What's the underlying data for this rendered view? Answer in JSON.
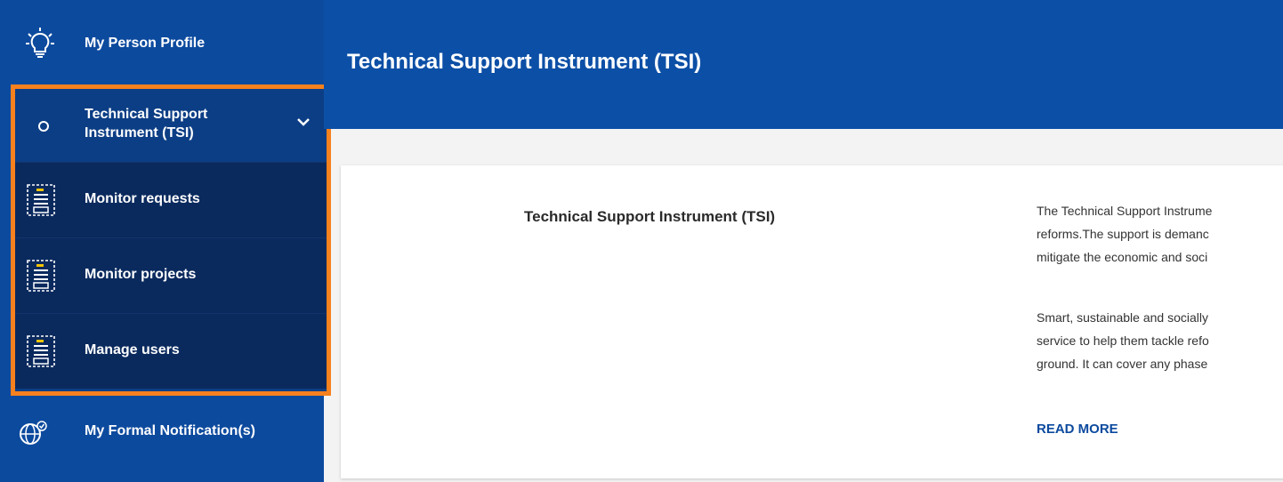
{
  "sidebar": {
    "profile": {
      "label": "My Person Profile",
      "icon": "lightbulb-icon"
    },
    "tsi_group": {
      "label": "Technical Support Instrument (TSI)",
      "items": [
        {
          "label": "Monitor requests",
          "icon": "document-list-icon"
        },
        {
          "label": "Monitor projects",
          "icon": "document-list-icon"
        },
        {
          "label": "Manage users",
          "icon": "document-list-icon"
        }
      ]
    },
    "formal_notifications": {
      "label": "My Formal Notification(s)",
      "icon": "globe-check-icon"
    }
  },
  "header": {
    "title": "Technical Support Instrument (TSI)"
  },
  "card": {
    "title": "Technical Support Instrument (TSI)",
    "paragraph1": [
      "The Technical Support Instrume",
      "reforms.The support is demanc",
      "mitigate the economic and soci"
    ],
    "paragraph2": [
      "Smart, sustainable and socially",
      "service to help them tackle refo",
      "ground. It can cover any phase"
    ],
    "read_more": "READ MORE"
  },
  "colors": {
    "sidebar_bg": "#0c4a9e",
    "submenu_bg": "#0a2a5e",
    "highlight_border": "#f7811e",
    "header_bg": "#0c4fa6",
    "accent_yellow": "#f5c400"
  }
}
